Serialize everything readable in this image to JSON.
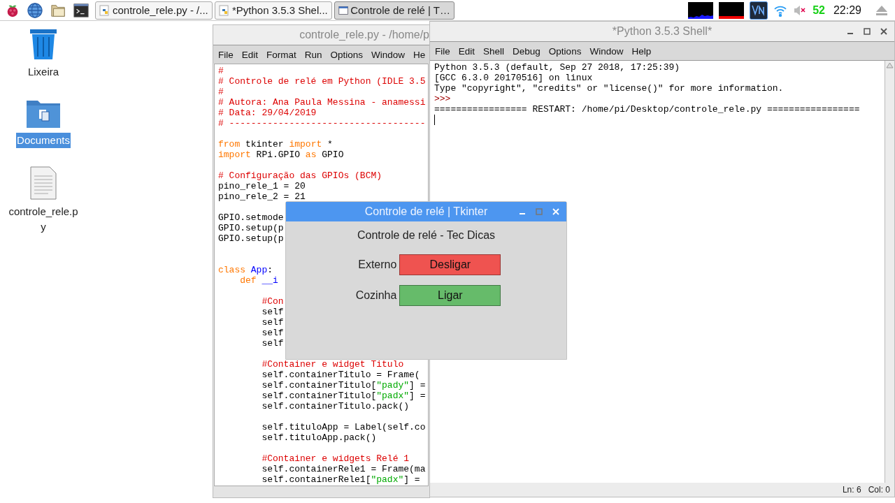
{
  "taskbar": {
    "tasks": [
      {
        "label": "controle_rele.py - /...",
        "kind": "python",
        "selected": false
      },
      {
        "label": "*Python 3.5.3 Shel...",
        "kind": "python",
        "selected": false
      },
      {
        "label": "Controle de relé | T…",
        "kind": "window",
        "selected": true
      }
    ],
    "cpu_temp": "52",
    "clock": "22:29"
  },
  "desktop_icons": [
    {
      "label": "Lixeira",
      "kind": "trash",
      "selected": false
    },
    {
      "label": "Documents",
      "kind": "folder",
      "selected": true
    },
    {
      "label": "controle_rele.py",
      "kind": "file",
      "selected": false
    }
  ],
  "editor": {
    "title": "controle_rele.py - /home/p",
    "menu": [
      "File",
      "Edit",
      "Format",
      "Run",
      "Options",
      "Window",
      "He"
    ],
    "lines": [
      {
        "kind": "code",
        "segments": [
          {
            "kind": "comment",
            "text": "#"
          }
        ]
      },
      {
        "kind": "code",
        "segments": [
          {
            "kind": "comment",
            "text": "# Controle de relé em Python (IDLE 3.5"
          }
        ]
      },
      {
        "kind": "code",
        "segments": [
          {
            "kind": "comment",
            "text": "#"
          }
        ]
      },
      {
        "kind": "code",
        "segments": [
          {
            "kind": "comment",
            "text": "# Autora: Ana Paula Messina - anamessi"
          }
        ]
      },
      {
        "kind": "code",
        "segments": [
          {
            "kind": "comment",
            "text": "# Data: 29/04/2019"
          }
        ]
      },
      {
        "kind": "code",
        "segments": [
          {
            "kind": "comment",
            "text": "# ------------------------------------"
          }
        ]
      },
      {
        "kind": "blank"
      },
      {
        "kind": "code",
        "segments": [
          {
            "kind": "keyword",
            "text": "from"
          },
          {
            "kind": "plain",
            "text": " tkinter "
          },
          {
            "kind": "keyword",
            "text": "import"
          },
          {
            "kind": "plain",
            "text": " *"
          }
        ]
      },
      {
        "kind": "code",
        "segments": [
          {
            "kind": "keyword",
            "text": "import"
          },
          {
            "kind": "plain",
            "text": " RPi.GPIO "
          },
          {
            "kind": "keyword",
            "text": "as"
          },
          {
            "kind": "plain",
            "text": " GPIO"
          }
        ]
      },
      {
        "kind": "blank"
      },
      {
        "kind": "code",
        "segments": [
          {
            "kind": "comment",
            "text": "# Configuração das GPIOs (BCM)"
          }
        ]
      },
      {
        "kind": "code",
        "segments": [
          {
            "kind": "plain",
            "text": "pino_rele_1 = 20"
          }
        ]
      },
      {
        "kind": "code",
        "segments": [
          {
            "kind": "plain",
            "text": "pino_rele_2 = 21"
          }
        ]
      },
      {
        "kind": "blank"
      },
      {
        "kind": "code",
        "segments": [
          {
            "kind": "plain",
            "text": "GPIO.setmode"
          }
        ]
      },
      {
        "kind": "code",
        "segments": [
          {
            "kind": "plain",
            "text": "GPIO.setup(p"
          }
        ]
      },
      {
        "kind": "code",
        "segments": [
          {
            "kind": "plain",
            "text": "GPIO.setup(p"
          }
        ]
      },
      {
        "kind": "blank"
      },
      {
        "kind": "blank"
      },
      {
        "kind": "code",
        "segments": [
          {
            "kind": "keyword",
            "text": "class "
          },
          {
            "kind": "name",
            "text": "App"
          },
          {
            "kind": "plain",
            "text": ":"
          }
        ]
      },
      {
        "kind": "code",
        "segments": [
          {
            "kind": "keyword",
            "text": "    def "
          },
          {
            "kind": "name",
            "text": "__i"
          }
        ]
      },
      {
        "kind": "blank"
      },
      {
        "kind": "code",
        "segments": [
          {
            "kind": "comment",
            "text": "        #Con"
          }
        ]
      },
      {
        "kind": "code",
        "segments": [
          {
            "kind": "plain",
            "text": "        self"
          }
        ]
      },
      {
        "kind": "code",
        "segments": [
          {
            "kind": "plain",
            "text": "        self"
          }
        ]
      },
      {
        "kind": "code",
        "segments": [
          {
            "kind": "plain",
            "text": "        self"
          }
        ]
      },
      {
        "kind": "code",
        "segments": [
          {
            "kind": "plain",
            "text": "        self"
          }
        ]
      },
      {
        "kind": "blank"
      },
      {
        "kind": "code",
        "segments": [
          {
            "kind": "comment",
            "text": "        #Container e widget Titulo"
          }
        ]
      },
      {
        "kind": "code",
        "segments": [
          {
            "kind": "plain",
            "text": "        self.containerTitulo = Frame("
          }
        ]
      },
      {
        "kind": "code",
        "segments": [
          {
            "kind": "plain",
            "text": "        self.containerTitulo["
          },
          {
            "kind": "string",
            "text": "\"pady\""
          },
          {
            "kind": "plain",
            "text": "] ="
          }
        ]
      },
      {
        "kind": "code",
        "segments": [
          {
            "kind": "plain",
            "text": "        self.containerTitulo["
          },
          {
            "kind": "string",
            "text": "\"padx\""
          },
          {
            "kind": "plain",
            "text": "] ="
          }
        ]
      },
      {
        "kind": "code",
        "segments": [
          {
            "kind": "plain",
            "text": "        self.containerTitulo.pack()"
          }
        ]
      },
      {
        "kind": "blank"
      },
      {
        "kind": "code",
        "segments": [
          {
            "kind": "plain",
            "text": "        self.tituloApp = Label(self.co"
          }
        ]
      },
      {
        "kind": "code",
        "segments": [
          {
            "kind": "plain",
            "text": "        self.tituloApp.pack()"
          }
        ]
      },
      {
        "kind": "blank"
      },
      {
        "kind": "code",
        "segments": [
          {
            "kind": "comment",
            "text": "        #Container e widgets Relé 1"
          }
        ]
      },
      {
        "kind": "code",
        "segments": [
          {
            "kind": "plain",
            "text": "        self.containerRele1 = Frame(ma"
          }
        ]
      },
      {
        "kind": "code",
        "segments": [
          {
            "kind": "plain",
            "text": "        self.containerRele1["
          },
          {
            "kind": "string",
            "text": "\"padx\""
          },
          {
            "kind": "plain",
            "text": "] ="
          }
        ]
      }
    ]
  },
  "shell": {
    "title": "*Python 3.5.3 Shell*",
    "menu": [
      "File",
      "Edit",
      "Shell",
      "Debug",
      "Options",
      "Window",
      "Help"
    ],
    "lines": [
      {
        "kind": "output",
        "text": "Python 3.5.3 (default, Sep 27 2018, 17:25:39)"
      },
      {
        "kind": "output",
        "text": "[GCC 6.3.0 20170516] on linux"
      },
      {
        "kind": "output",
        "text": "Type \"copyright\", \"credits\" or \"license()\" for more information."
      },
      {
        "kind": "prompt",
        "text": ">>>"
      },
      {
        "kind": "output",
        "text": "================= RESTART: /home/pi/Desktop/controle_rele.py ================="
      }
    ],
    "line": "Ln: 6",
    "col": "Col: 0"
  },
  "tk_window": {
    "title": "Controle de relé | Tkinter",
    "heading": "Controle de relé - Tec Dicas",
    "rows": [
      {
        "label": "Externo",
        "button": "Desligar",
        "color": "#ef5350"
      },
      {
        "label": "Cozinha",
        "button": "Ligar",
        "color": "#66bb6a"
      }
    ]
  }
}
